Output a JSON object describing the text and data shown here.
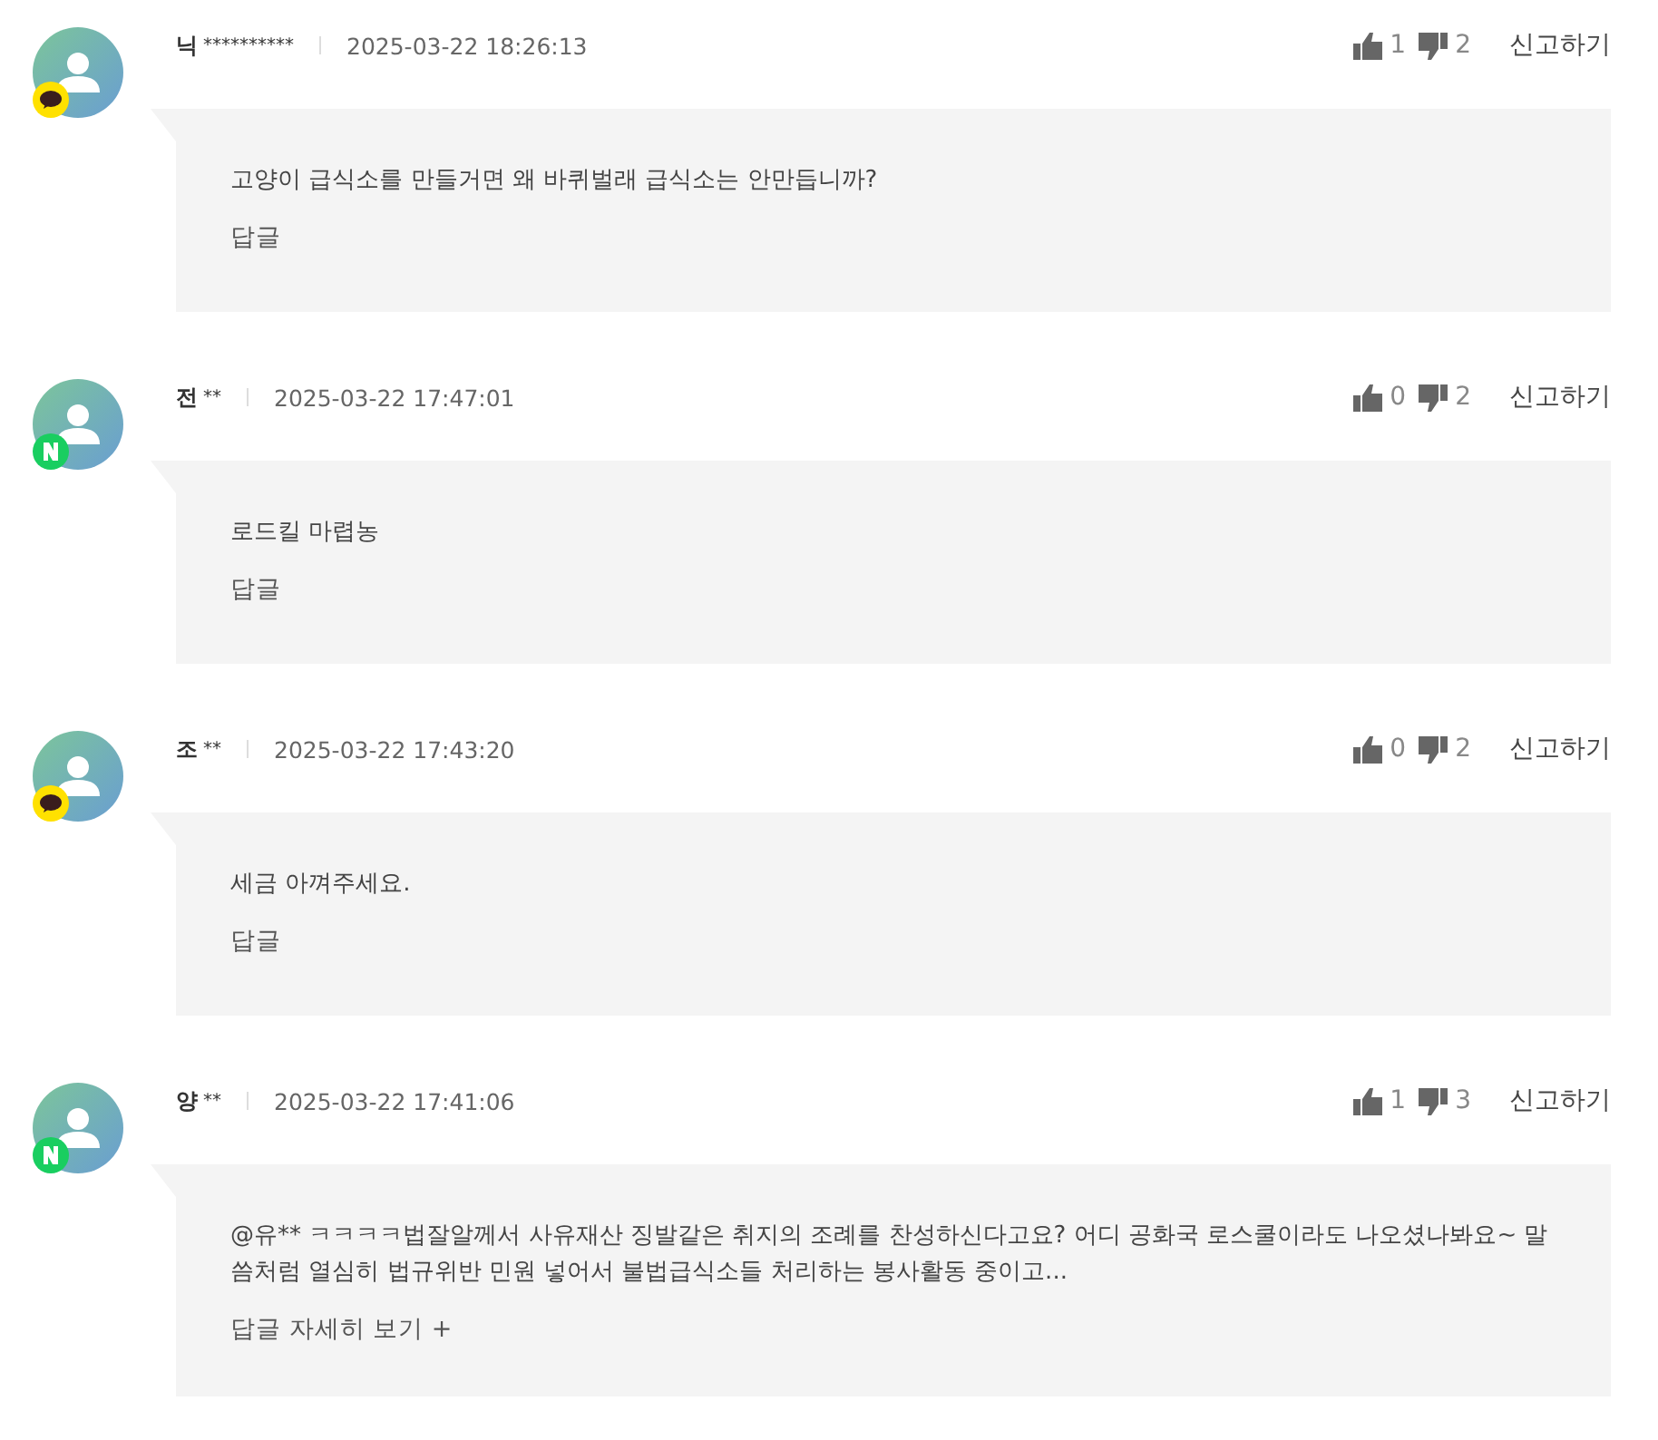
{
  "comments": [
    {
      "kind": "kakao",
      "name": "닉",
      "mask": "**********",
      "date": "2025-03-22 18:26:13",
      "likes": "1",
      "dislikes": "2",
      "report": "신고하기",
      "text": "고양이 급식소를 만들거면 왜 바퀴벌래 급식소는 안만듭니까?",
      "reply": "답글"
    },
    {
      "kind": "naver",
      "name": "전",
      "mask": "**",
      "date": "2025-03-22 17:47:01",
      "likes": "0",
      "dislikes": "2",
      "report": "신고하기",
      "text": "로드킬 마렵농",
      "reply": "답글"
    },
    {
      "kind": "kakao",
      "name": "조",
      "mask": "**",
      "date": "2025-03-22 17:43:20",
      "likes": "0",
      "dislikes": "2",
      "report": "신고하기",
      "text": "세금 아껴주세요.",
      "reply": "답글"
    },
    {
      "kind": "naver",
      "name": "양",
      "mask": "**",
      "date": "2025-03-22 17:41:06",
      "likes": "1",
      "dislikes": "3",
      "report": "신고하기",
      "text": "@유** ㅋㅋㅋㅋ법잘알께서 사유재산 징발같은 취지의 조례를 찬성하신다고요? 어디 공화국 로스쿨이라도 나오셨나봐요~ 말씀처럼 열심히 법규위반 민원 넣어서 불법급식소들 처리하는 봉사활동 중이고...",
      "reply": "답글 자세히 보기 +"
    }
  ]
}
